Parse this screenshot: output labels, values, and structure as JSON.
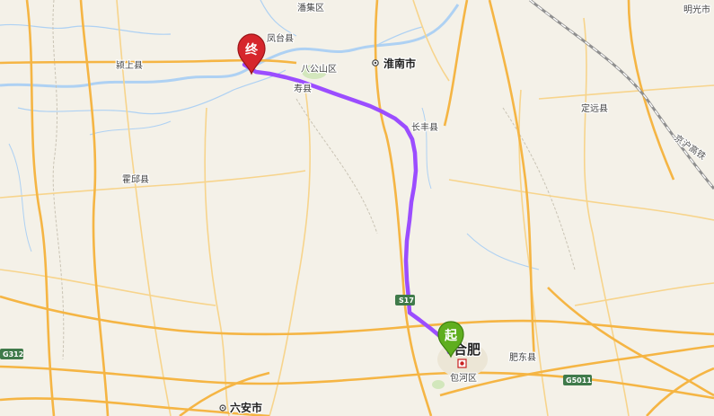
{
  "map": {
    "labels": {
      "panji": "潘集区",
      "mingguang": "明光市",
      "fengtai": "凤台县",
      "yingshang": "颍上县",
      "bagongshan": "八公山区",
      "huainan": "淮南市",
      "shou": "寿县",
      "dingyuan": "定远县",
      "changfeng": "长丰县",
      "jinghu_rail": "京沪高铁",
      "huoqiu": "霍邱县",
      "hefei": "合肥",
      "feidong": "肥东县",
      "baohe": "包河区",
      "luan": "六安市"
    },
    "shields": {
      "g312": "G312",
      "s17": "S17",
      "g5011": "G5011"
    },
    "markers": {
      "start": "起",
      "end": "终"
    },
    "colors": {
      "route": "#9b4dff",
      "start_marker": "#5fae1f",
      "end_marker": "#d6262c",
      "highway": "#f5b544",
      "water": "#aed1f3"
    }
  }
}
